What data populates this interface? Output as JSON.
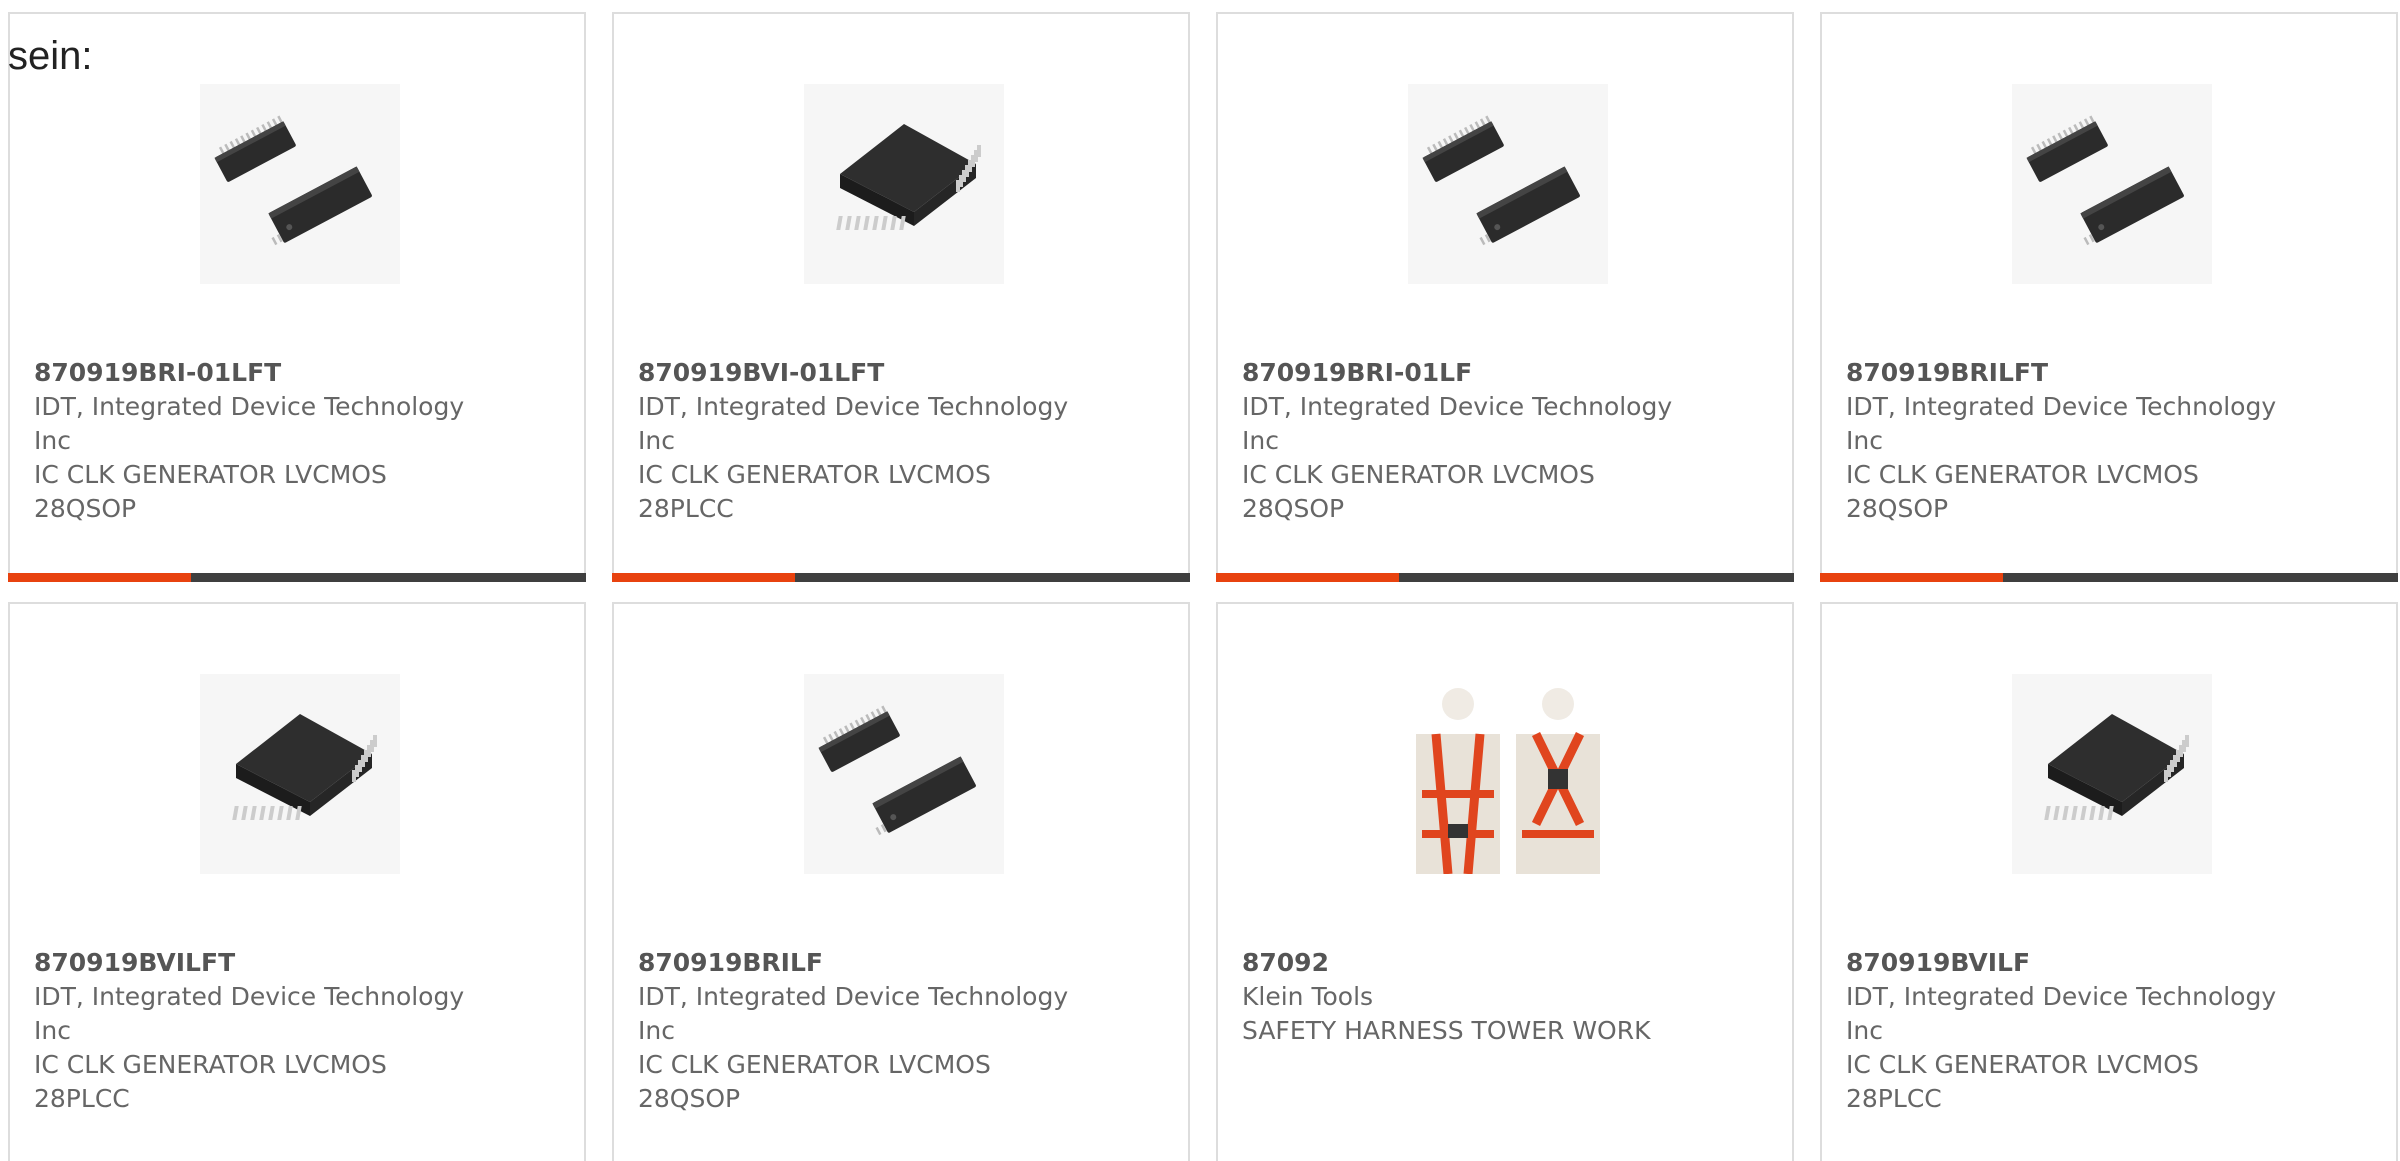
{
  "header": {
    "fragment": "sein:"
  },
  "colors": {
    "accent": "#e8420f",
    "bar": "#3f3f3f",
    "border": "#dddddd",
    "text": "#666666"
  },
  "products": [
    {
      "part_number": "870919BRI-01LFT",
      "manufacturer": "IDT, Integrated Device Technology Inc",
      "description": "IC CLK GENERATOR LVCMOS 28QSOP",
      "icon": "qsop-chip-icon"
    },
    {
      "part_number": "870919BVI-01LFT",
      "manufacturer": "IDT, Integrated Device Technology Inc",
      "description": "IC CLK GENERATOR LVCMOS 28PLCC",
      "icon": "plcc-chip-icon"
    },
    {
      "part_number": "870919BRI-01LF",
      "manufacturer": "IDT, Integrated Device Technology Inc",
      "description": "IC CLK GENERATOR LVCMOS 28QSOP",
      "icon": "qsop-chip-icon"
    },
    {
      "part_number": "870919BRILFT",
      "manufacturer": "IDT, Integrated Device Technology Inc",
      "description": "IC CLK GENERATOR LVCMOS 28QSOP",
      "icon": "qsop-chip-icon"
    },
    {
      "part_number": "870919BVILFT",
      "manufacturer": "IDT, Integrated Device Technology Inc",
      "description": "IC CLK GENERATOR LVCMOS 28PLCC",
      "icon": "plcc-chip-icon"
    },
    {
      "part_number": "870919BRILF",
      "manufacturer": "IDT, Integrated Device Technology Inc",
      "description": "IC CLK GENERATOR LVCMOS 28QSOP",
      "icon": "qsop-chip-icon"
    },
    {
      "part_number": "87092",
      "manufacturer": "Klein Tools",
      "description": "SAFETY HARNESS TOWER WORK",
      "icon": "safety-harness-icon"
    },
    {
      "part_number": "870919BVILF",
      "manufacturer": "IDT, Integrated Device Technology Inc",
      "description": "IC CLK GENERATOR LVCMOS 28PLCC",
      "icon": "plcc-chip-icon"
    }
  ]
}
